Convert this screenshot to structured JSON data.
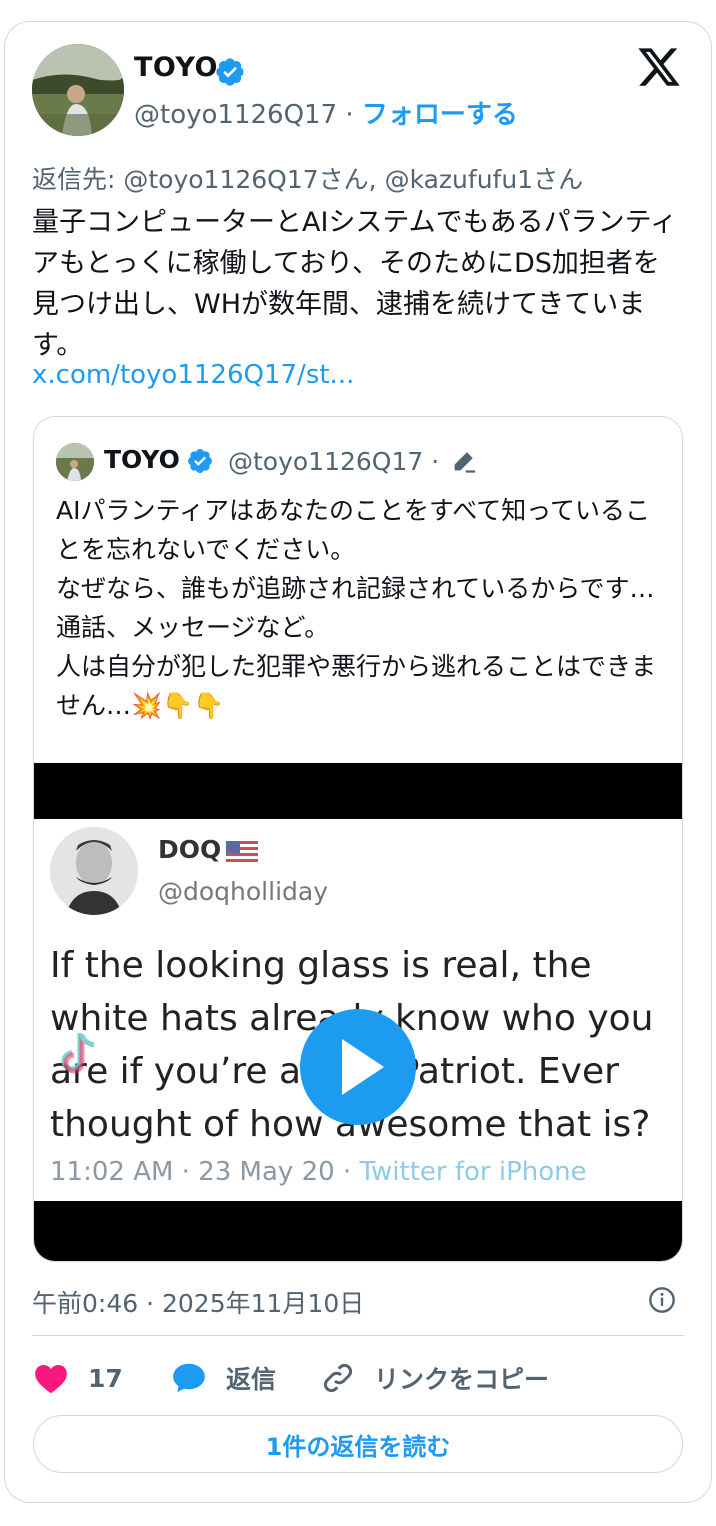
{
  "author": {
    "name": "TOYO",
    "handle": "@toyo1126Q17",
    "separator": "·",
    "follow_label": "フォローする"
  },
  "reply_to": "返信先: @toyo1126Q17さん, @kazufufu1さん",
  "body": "量子コンピューターとAIシステムでもあるパランティアもとっくに稼働しており、そのためにDS加担者を見つけ出し、WHが数年間、逮捕を続けてきています。",
  "link": "x.com/toyo1126Q17/st...",
  "quote": {
    "name": "TOYO",
    "handle": "@toyo1126Q17",
    "separator": "·",
    "text": "AIパランティアはあなたのことをすべて知っていることを忘れないでください。\nなぜなら、誰もが追跡され記録されているからです…通話、メッセージなど。\n人は自分が犯した犯罪や悪行から逃れることはできません…💥👇👇",
    "media": {
      "tweet_name": "DOQ",
      "tweet_handle": "@doqholliday",
      "tweet_text": "If the looking glass is real, the white hats already know who you are if you’re a true Patriot. Ever thought of how awesome that is?",
      "tweet_time": "11:02 AM · 23 May 20 · ",
      "tweet_source": "Twitter for iPhone"
    }
  },
  "timestamp": "午前0:46 · 2025年11月10日",
  "actions": {
    "like_count": "17",
    "reply_label": "返信",
    "copy_link_label": "リンクをコピー"
  },
  "read_replies_label": "1件の返信を読む",
  "colors": {
    "accent": "#1d9bf0",
    "like": "#f91880",
    "text": "#0f1419",
    "muted": "#536471"
  }
}
